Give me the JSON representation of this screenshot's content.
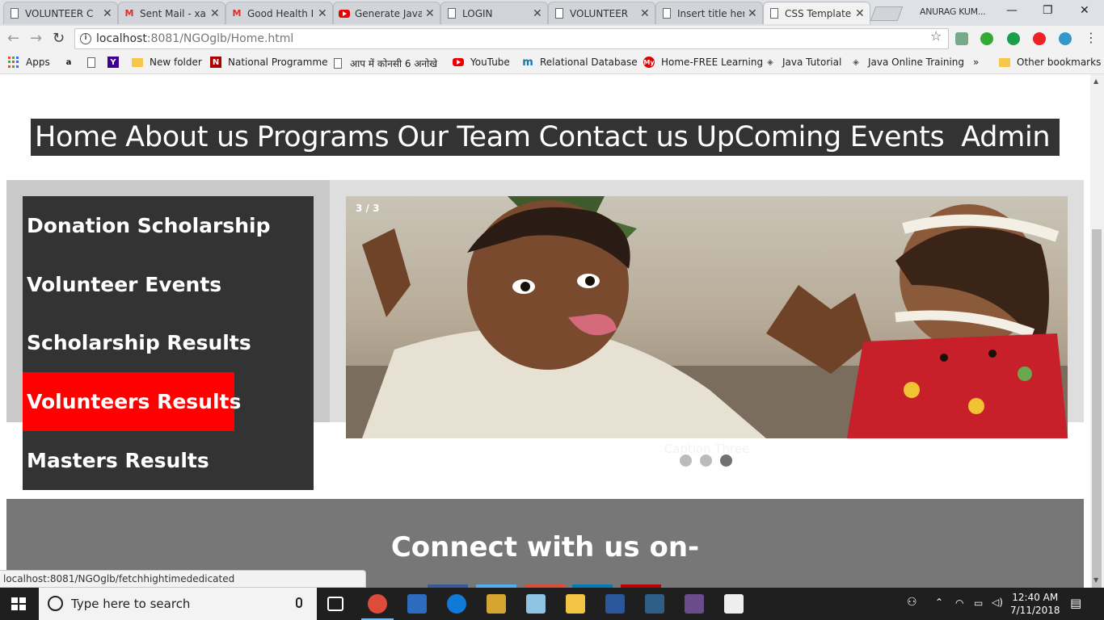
{
  "browser": {
    "tabs": [
      {
        "title": "VOLUNTEER C",
        "icon": "document-icon",
        "active": false
      },
      {
        "title": "Sent Mail - xa",
        "icon": "gmail-icon",
        "active": false
      },
      {
        "title": "Good Health I",
        "icon": "gmail-icon",
        "active": false
      },
      {
        "title": "Generate Java",
        "icon": "youtube-icon",
        "active": false
      },
      {
        "title": "LOGIN",
        "icon": "document-icon",
        "active": false
      },
      {
        "title": "VOLUNTEER",
        "icon": "document-icon",
        "active": false
      },
      {
        "title": "Insert title her",
        "icon": "document-icon",
        "active": false
      },
      {
        "title": "CSS Template",
        "icon": "document-icon",
        "active": true
      }
    ],
    "profile_name": "ANURAG KUM...",
    "url_host": "localhost",
    "url_path": ":8081/NGOglb/Home.html",
    "bookmarks": {
      "apps": "Apps",
      "new_folder": "New folder",
      "national": "National Programme",
      "hindi": "आप में कोनसी 6 अनोखे",
      "youtube": "YouTube",
      "relational": "Relational Database",
      "home_free": "Home-FREE Learning",
      "java_tutorial": "Java Tutorial",
      "java_online": "Java Online Training",
      "more": "»",
      "other": "Other bookmarks"
    },
    "status_url": "localhost:8081/NGOglb/fetchhightimededicated"
  },
  "page": {
    "nav": [
      "Home",
      "About us",
      "Programs",
      "Our Team",
      "Contact us",
      "UpComing Events",
      " Admin"
    ],
    "sidebar": [
      "Donation Scholarship",
      "Volunteer Events",
      "Scholarship Results",
      "Volunteers Results",
      "Masters Results"
    ],
    "sidebar_active_index": 3,
    "slideshow": {
      "number_text": "3 / 3",
      "caption": "Caption Three",
      "dots": 3,
      "active_dot": 2
    },
    "footer": {
      "heading": "Connect with us on-",
      "social_colors": [
        "#3b5998",
        "#55acee",
        "#dd4b39",
        "#007bb5",
        "#bb0000"
      ]
    }
  },
  "taskbar": {
    "search_placeholder": "Type here to search",
    "time": "12:40 AM",
    "date": "7/11/2018"
  },
  "colors": {
    "nav_bg": "#333333",
    "sidebar_active": "#ff0000",
    "footer_bg": "#777777"
  }
}
